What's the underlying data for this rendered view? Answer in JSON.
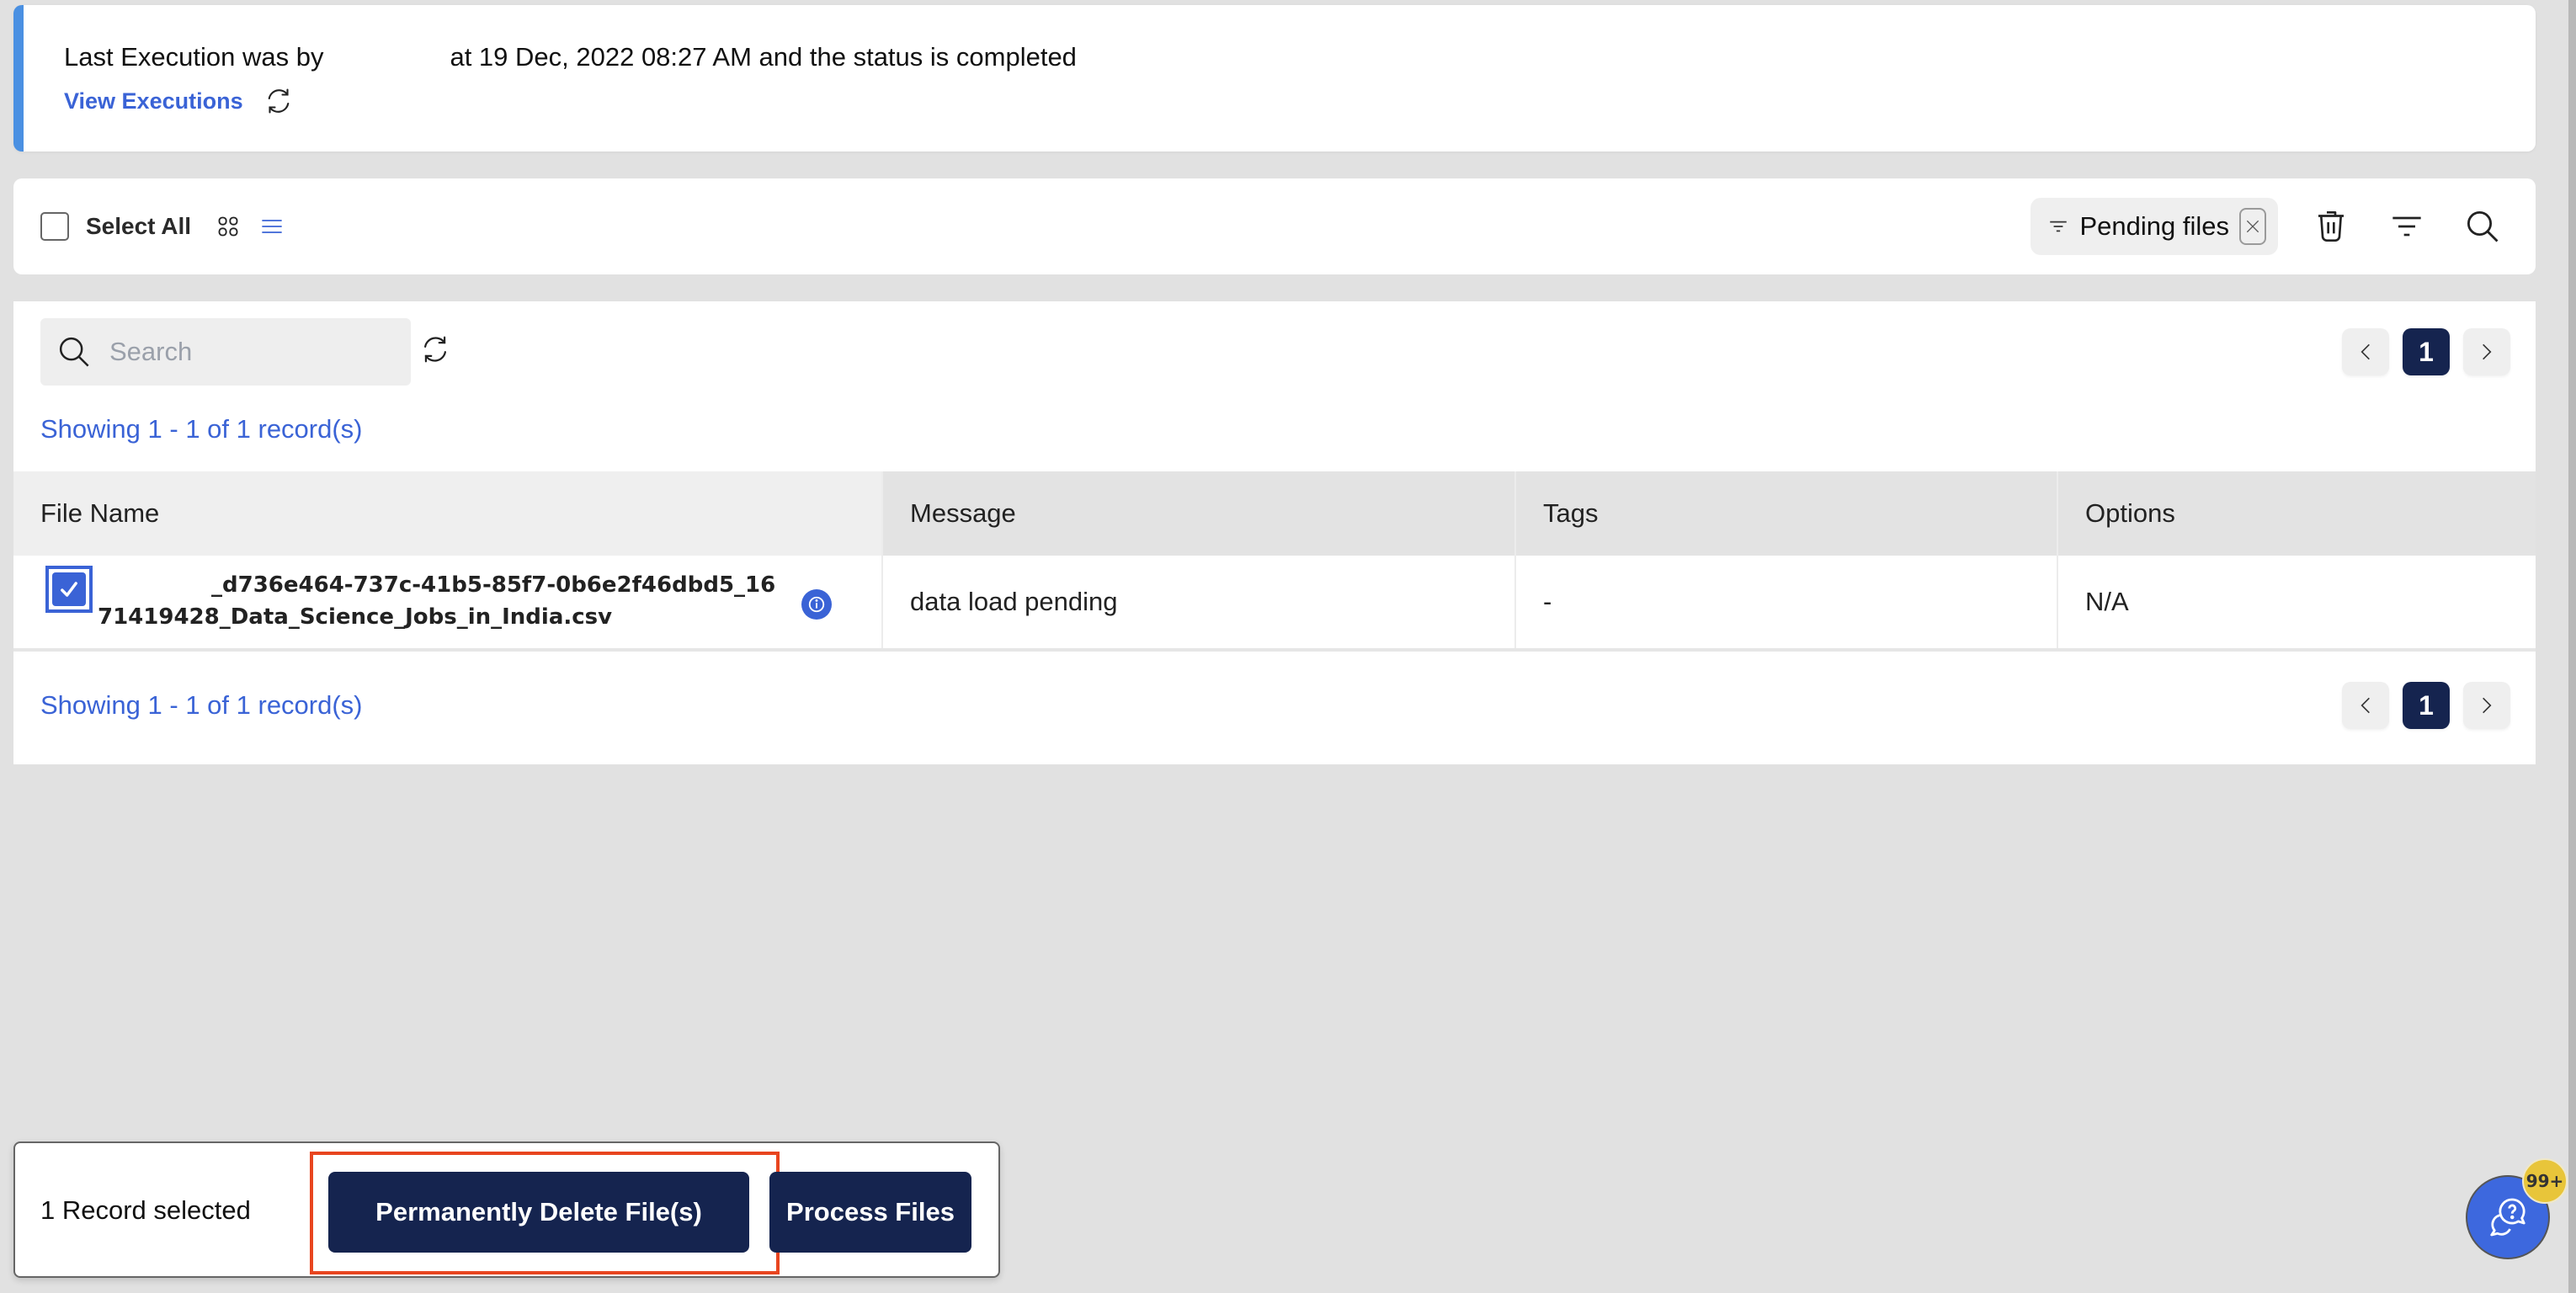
{
  "banner": {
    "text_before": "Last Execution was by",
    "text_after": "at 19 Dec, 2022 08:27 AM and the status is completed",
    "view_executions_label": "View Executions",
    "accent_color": "#4a90e2"
  },
  "toolbar": {
    "select_all_label": "Select All",
    "select_all_checked": false,
    "view_modes": [
      "grid-view-icon",
      "list-view-icon"
    ],
    "active_view": "list",
    "filter_chip_label": "Pending files",
    "actions": [
      "delete-icon",
      "filter-icon",
      "search-icon"
    ]
  },
  "panel": {
    "search_placeholder": "Search",
    "search_value": "",
    "showing_text": "Showing 1 - 1 of 1 record(s)",
    "current_page": "1"
  },
  "table": {
    "columns": [
      "File Name",
      "Message",
      "Tags",
      "Options"
    ],
    "rows": [
      {
        "checked": true,
        "file_name": "_d736e464-737c-41b5-85f7-0b6e2f46dbd5_1671419428_Data_Science_Jobs_in_India.csv",
        "message": "data load pending",
        "tags": "-",
        "options": "N/A"
      }
    ]
  },
  "action_bar": {
    "selected_text": "1 Record selected",
    "delete_label": "Permanently Delete File(s)",
    "process_label": "Process Files"
  },
  "help": {
    "badge": "99+"
  },
  "colors": {
    "primary_navy": "#15244f",
    "link_blue": "#3a63d6",
    "highlight_red": "#e8451f",
    "badge_yellow": "#e8c53a"
  }
}
